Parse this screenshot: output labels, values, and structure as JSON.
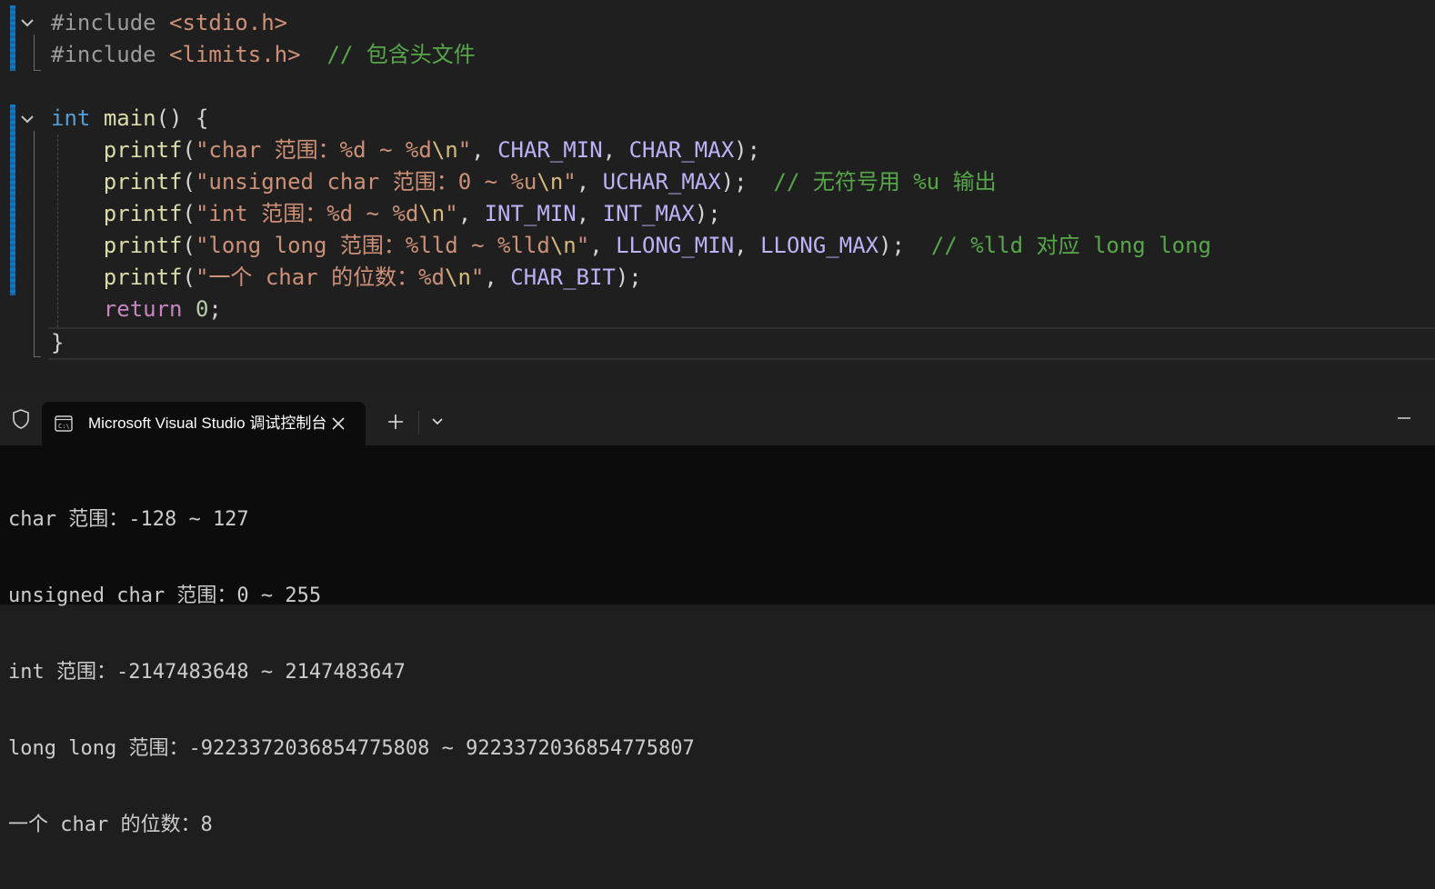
{
  "editor": {
    "lines": {
      "l1": {
        "pre": "#include",
        "header": "<stdio.h>"
      },
      "l2": {
        "pre": "#include",
        "header": "<limits.h>",
        "comment": "// 包含头文件"
      },
      "l4": {
        "type": "int",
        "name": "main",
        "rest": "() {"
      },
      "l5": {
        "fn": "printf",
        "s1": "\"char 范围：%d ~ %d",
        "esc": "\\n",
        "s2": "\"",
        "args_sep1": ", ",
        "m1": "CHAR_MIN",
        "args_sep2": ", ",
        "m2": "CHAR_MAX",
        "end": ");"
      },
      "l6": {
        "fn": "printf",
        "s1": "\"unsigned char 范围：0 ~ %u",
        "esc": "\\n",
        "s2": "\"",
        "args_sep1": ", ",
        "m1": "UCHAR_MAX",
        "end": ");",
        "comment": "// 无符号用 %u 输出"
      },
      "l7": {
        "fn": "printf",
        "s1": "\"int 范围：%d ~ %d",
        "esc": "\\n",
        "s2": "\"",
        "args_sep1": ", ",
        "m1": "INT_MIN",
        "args_sep2": ", ",
        "m2": "INT_MAX",
        "end": ");"
      },
      "l8": {
        "fn": "printf",
        "s1": "\"long long 范围：%lld ~ %lld",
        "esc": "\\n",
        "s2": "\"",
        "args_sep1": ", ",
        "m1": "LLONG_MIN",
        "args_sep2": ", ",
        "m2": "LLONG_MAX",
        "end": ");",
        "comment": "// %lld 对应 long long"
      },
      "l9": {
        "fn": "printf",
        "s1": "\"一个 char 的位数：%d",
        "esc": "\\n",
        "s2": "\"",
        "args_sep1": ", ",
        "m1": "CHAR_BIT",
        "end": ");"
      },
      "l10": {
        "kw": "return",
        "num": "0",
        "end": ";"
      },
      "l11": {
        "brace": "}"
      }
    }
  },
  "terminal": {
    "tab_title": "Microsoft Visual Studio 调试控制台",
    "icons": {
      "shield": "shield-icon",
      "tab": "console-icon",
      "close": "close-icon",
      "new_tab": "plus-icon",
      "dropdown": "chevron-down-icon",
      "minimize": "minimize-icon"
    },
    "output": [
      "char 范围：-128 ~ 127",
      "unsigned char 范围：0 ~ 255",
      "int 范围：-2147483648 ~ 2147483647",
      "long long 范围：-9223372036854775808 ~ 9223372036854775807",
      "一个 char 的位数：8"
    ]
  },
  "colors": {
    "keyword": "#569cd6",
    "control": "#c586c0",
    "function": "#dcdcaa",
    "string": "#ce9178",
    "macro": "#bcb3f6",
    "comment": "#57a64a",
    "terminal_bg": "#0c0c0c"
  }
}
